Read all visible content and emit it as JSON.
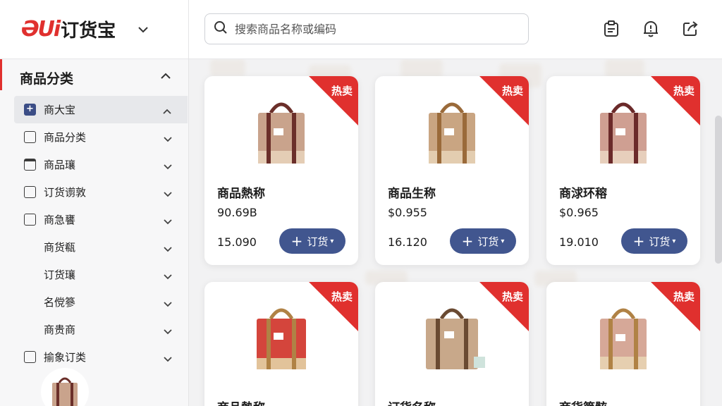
{
  "brand": {
    "logo_mark": "ƏUi",
    "name": "订货宝"
  },
  "search": {
    "placeholder": "搜索商品名称或编码"
  },
  "sidebar": {
    "section_title": "商品分类",
    "items": [
      {
        "label": "商大宝",
        "icon": "plus-box-icon",
        "active": true
      },
      {
        "label": "商品分类",
        "icon": "tag-icon"
      },
      {
        "label": "商品瓖",
        "icon": "window-icon"
      },
      {
        "label": "订货谫敦",
        "icon": "document-icon"
      },
      {
        "label": "商急饔",
        "icon": "box-icon"
      },
      {
        "label": "商货瓻",
        "sub": true
      },
      {
        "label": "订货瓖",
        "sub": true
      },
      {
        "label": "名傥篸",
        "sub": true
      },
      {
        "label": "商贵商",
        "sub": true
      },
      {
        "label": "揄象订类",
        "icon": "export-icon"
      }
    ]
  },
  "products": [
    {
      "badge": "热卖",
      "name": "商品熱称",
      "price": "90.69B",
      "stock": "15.090",
      "button": "订货",
      "bag_color": "#c9a38c",
      "strap_color": "#6b2f2a"
    },
    {
      "badge": "热卖",
      "name": "商品生称",
      "price": "$0.955",
      "stock": "16.120",
      "button": "订货",
      "bag_color": "#c9a582",
      "strap_color": "#9a6a3a"
    },
    {
      "badge": "热卖",
      "name": "商浗环穃",
      "price": "$0.965",
      "stock": "19.010",
      "button": "订货",
      "bag_color": "#cf9f92",
      "strap_color": "#6b2a2a"
    },
    {
      "badge": "热卖",
      "name": "商品熱称",
      "bag_color": "#d4453c",
      "strap_color": "#b08245"
    },
    {
      "badge": "热卖",
      "name": "订货名称",
      "bag_color": "#c8a88a",
      "strap_color": "#6a4a32"
    },
    {
      "badge": "热卖",
      "name": "商货篼骸",
      "bag_color": "#d6a898",
      "strap_color": "#b08245"
    }
  ],
  "colors": {
    "accent_red": "#e0302e",
    "button_blue": "#41568f"
  }
}
